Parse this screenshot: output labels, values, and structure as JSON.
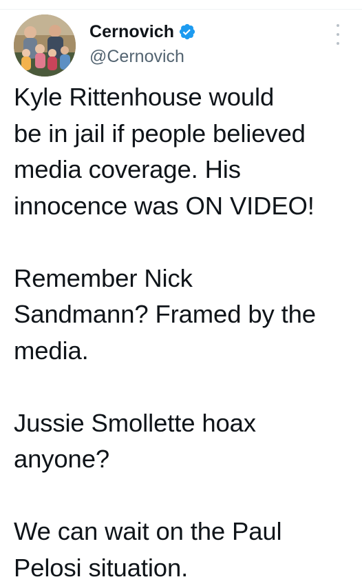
{
  "author": {
    "display_name": "Cernovich",
    "handle": "@Cernovich",
    "verified": true,
    "verified_color": "#1d9bf0"
  },
  "menu": {
    "icon": "more-vertical-icon"
  },
  "tweet": {
    "paragraphs": [
      {
        "lines": [
          "Kyle Rittenhouse would",
          "be in jail if people believed",
          "media coverage. His",
          "innocence was ON VIDEO!"
        ]
      },
      {
        "lines": [
          "Remember Nick",
          "Sandmann? Framed by the",
          "media."
        ]
      },
      {
        "lines": [
          "Jussie Smollette hoax",
          "anyone?"
        ]
      },
      {
        "lines": [
          "We can wait on the Paul",
          "Pelosi situation."
        ]
      }
    ]
  },
  "colors": {
    "text": "#0f1419",
    "secondary_text": "#536471",
    "divider": "#eff3f4"
  }
}
